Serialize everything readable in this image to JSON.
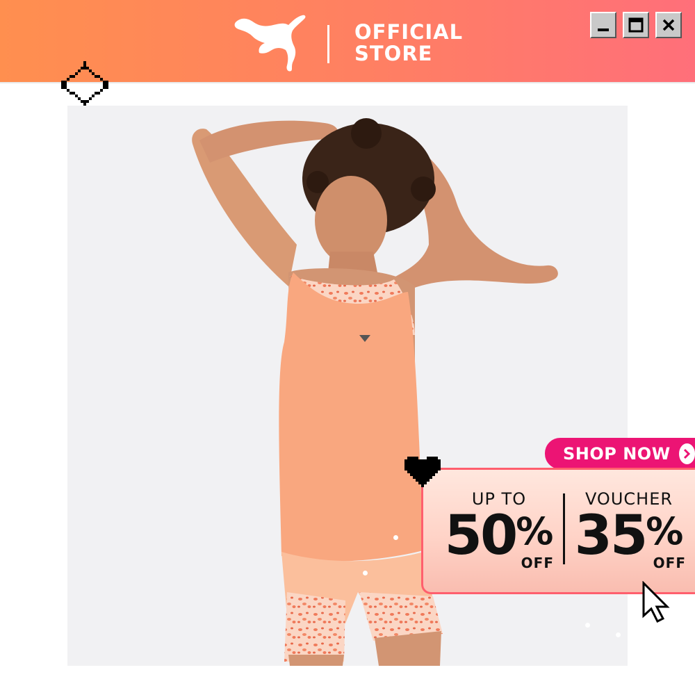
{
  "header": {
    "brand_logo_icon": "puma-cat-logo-icon",
    "store_line1": "OFFICIAL",
    "store_line2": "STORE",
    "window_controls": [
      "minimize-icon",
      "maximize-icon",
      "close-icon"
    ]
  },
  "hero": {
    "image": "model-in-peach-tank-top-and-printed-shorts",
    "sparkle_icon": "sparkle-icon"
  },
  "promo": {
    "shop_now_label": "SHOP NOW",
    "discount": {
      "top": "UP TO",
      "value": "50",
      "percent": "%",
      "suffix": "OFF"
    },
    "voucher": {
      "top": "VOUCHER",
      "value": "35",
      "percent": "%",
      "suffix": "OFF"
    },
    "heart_icon": "pixel-heart-icon",
    "cursor_icon": "pixel-cursor-icon"
  },
  "colors": {
    "header_start": "#ff8f4f",
    "header_end": "#ff6f7a",
    "shop_button": "#ec1474",
    "promo_border": "#ff5f6d",
    "top_peach": "#f9a77f"
  }
}
